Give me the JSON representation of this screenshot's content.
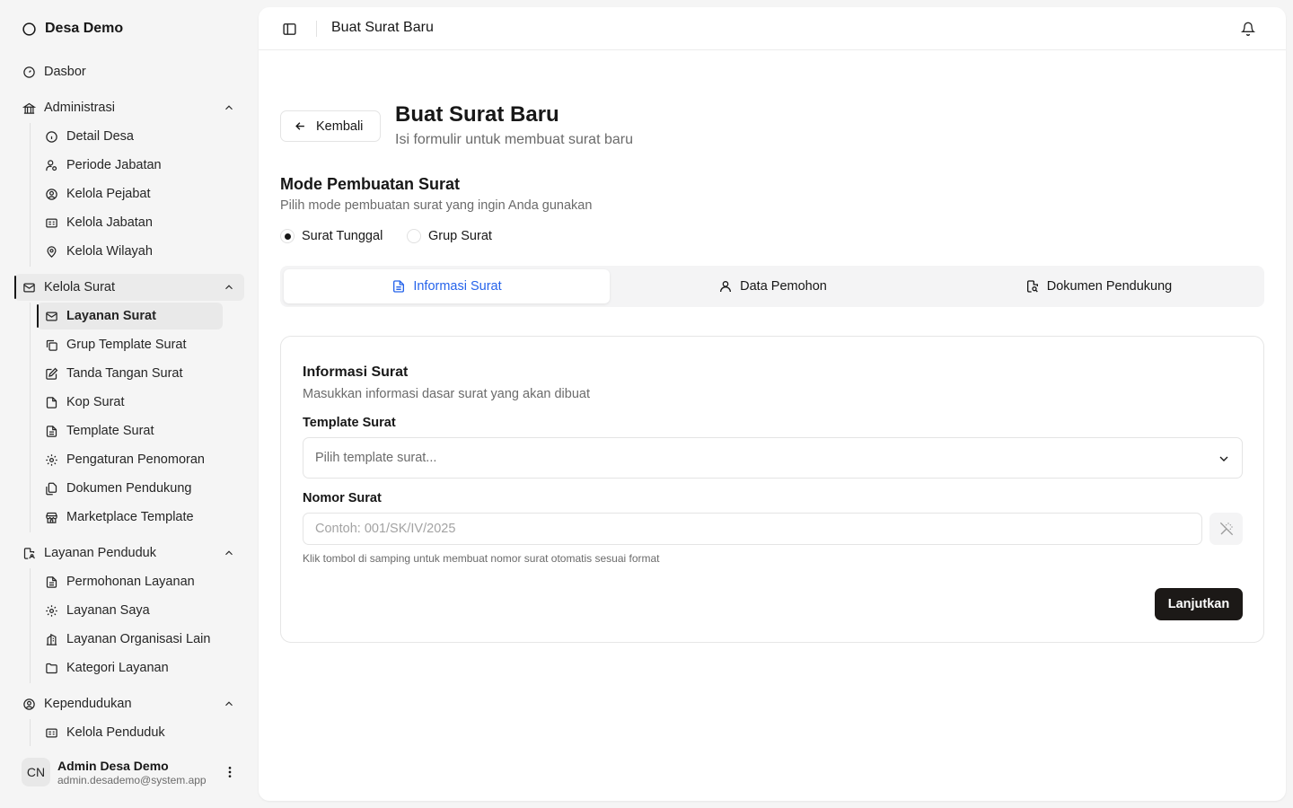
{
  "brand": {
    "name": "Desa Demo",
    "icon": "circle-logo-icon"
  },
  "sidebar": {
    "dashboard": "Dasbor",
    "groups": [
      {
        "label": "Administrasi",
        "items": [
          "Detail Desa",
          "Periode Jabatan",
          "Kelola Pejabat",
          "Kelola Jabatan",
          "Kelola Wilayah"
        ]
      },
      {
        "label": "Kelola Surat",
        "items": [
          "Layanan Surat",
          "Grup Template Surat",
          "Tanda Tangan Surat",
          "Kop Surat",
          "Template Surat",
          "Pengaturan Penomoran",
          "Dokumen Pendukung",
          "Marketplace Template"
        ]
      },
      {
        "label": "Layanan Penduduk",
        "items": [
          "Permohonan Layanan",
          "Layanan Saya",
          "Layanan Organisasi Lain",
          "Kategori Layanan"
        ]
      },
      {
        "label": "Kependudukan",
        "items": [
          "Kelola Penduduk"
        ]
      }
    ],
    "active_group": "Kelola Surat",
    "active_item": "Layanan Surat"
  },
  "user": {
    "initials": "CN",
    "name": "Admin Desa Demo",
    "email": "admin.desademo@system.app"
  },
  "topbar": {
    "title": "Buat Surat Baru"
  },
  "header": {
    "back_label": "Kembali",
    "title": "Buat Surat Baru",
    "subtitle": "Isi formulir untuk membuat surat baru"
  },
  "mode": {
    "title": "Mode Pembuatan Surat",
    "subtitle": "Pilih mode pembuatan surat yang ingin Anda gunakan",
    "options": [
      "Surat Tunggal",
      "Grup Surat"
    ],
    "selected": "Surat Tunggal"
  },
  "tabs": [
    "Informasi Surat",
    "Data Pemohon",
    "Dokumen Pendukung"
  ],
  "active_tab": "Informasi Surat",
  "form": {
    "title": "Informasi Surat",
    "subtitle": "Masukkan informasi dasar surat yang akan dibuat",
    "template_label": "Template Surat",
    "template_placeholder": "Pilih template surat...",
    "nomor_label": "Nomor Surat",
    "nomor_placeholder": "Contoh: 001/SK/IV/2025",
    "helper": "Klik tombol di samping untuk membuat nomor surat otomatis sesuai format",
    "submit_label": "Lanjutkan"
  },
  "colors": {
    "accent": "#2563eb",
    "primary_button": "#1c1917"
  }
}
